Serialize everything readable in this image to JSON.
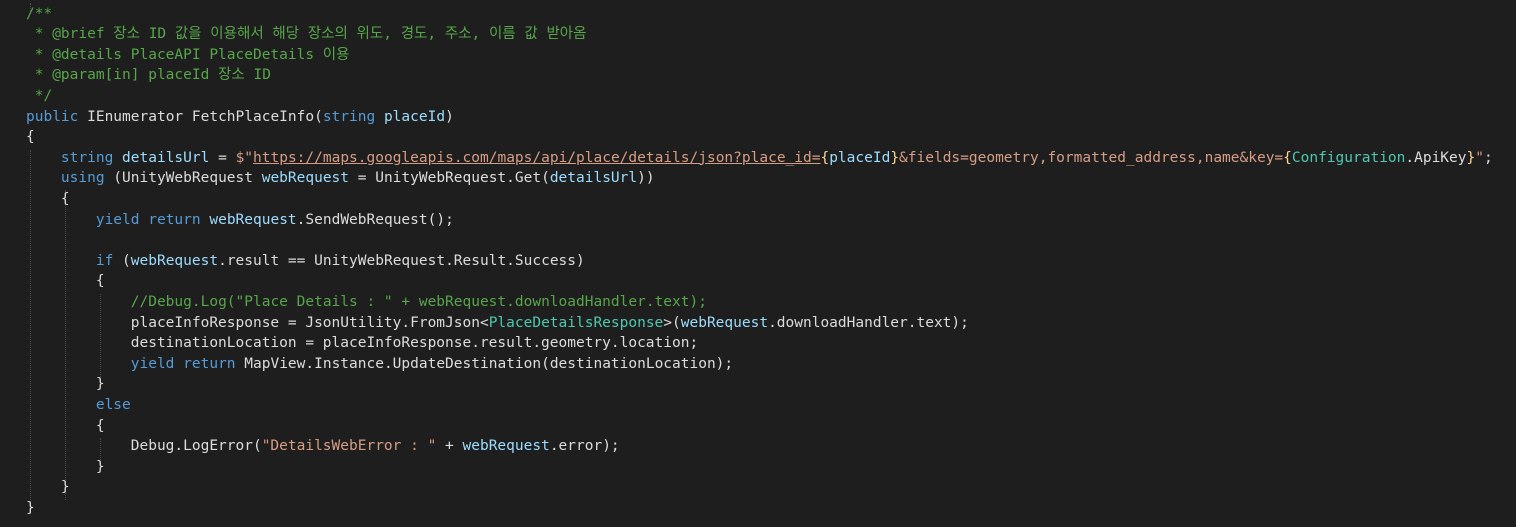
{
  "colors": {
    "background": "#1e1e1e",
    "default": "#dcdcdc",
    "keyword": "#569cd6",
    "comment": "#57a64a",
    "string": "#d69d85",
    "interp": "#ffd68f",
    "type": "#4ec9b0",
    "variable": "#9cdcfe",
    "indent_guide": "#4b4b4b"
  },
  "code": {
    "lines": [
      [
        {
          "t": "/**",
          "c": "comment"
        }
      ],
      [
        {
          "t": " * @brief 장소 ID 값을 이용해서 해당 장소의 위도, 경도, 주소, 이름 값 받아옴",
          "c": "comment"
        }
      ],
      [
        {
          "t": " * @details PlaceAPI PlaceDetails 이용",
          "c": "comment"
        }
      ],
      [
        {
          "t": " * @param[in] placeId 장소 ID",
          "c": "comment"
        }
      ],
      [
        {
          "t": " */",
          "c": "comment"
        }
      ],
      [
        {
          "t": "public",
          "c": "keyword"
        },
        {
          "t": " IEnumerator FetchPlaceInfo(",
          "c": "default"
        },
        {
          "t": "string",
          "c": "keyword"
        },
        {
          "t": " ",
          "c": "default"
        },
        {
          "t": "placeId",
          "c": "variable"
        },
        {
          "t": ")",
          "c": "default"
        }
      ],
      [
        {
          "t": "{",
          "c": "default"
        }
      ],
      [
        {
          "t": "    ",
          "c": "default"
        },
        {
          "t": "string",
          "c": "keyword"
        },
        {
          "t": " ",
          "c": "default"
        },
        {
          "t": "detailsUrl",
          "c": "variable"
        },
        {
          "t": " = ",
          "c": "default"
        },
        {
          "t": "$\"",
          "c": "string"
        },
        {
          "t": "https://maps.googleapis.com/maps/api/place/details/json?place_id=",
          "c": "string",
          "u": true
        },
        {
          "t": "{",
          "c": "interp"
        },
        {
          "t": "placeId",
          "c": "variable"
        },
        {
          "t": "}",
          "c": "interp"
        },
        {
          "t": "&fields=geometry,formatted_address,name&key=",
          "c": "string"
        },
        {
          "t": "{",
          "c": "interp"
        },
        {
          "t": "Configuration",
          "c": "type"
        },
        {
          "t": ".ApiKey",
          "c": "default"
        },
        {
          "t": "}",
          "c": "interp"
        },
        {
          "t": "\"",
          "c": "string"
        },
        {
          "t": ";",
          "c": "default"
        }
      ],
      [
        {
          "t": "    ",
          "c": "default"
        },
        {
          "t": "using",
          "c": "keyword"
        },
        {
          "t": " (UnityWebRequest ",
          "c": "default"
        },
        {
          "t": "webRequest",
          "c": "variable"
        },
        {
          "t": " = UnityWebRequest.Get(",
          "c": "default"
        },
        {
          "t": "detailsUrl",
          "c": "variable"
        },
        {
          "t": "))",
          "c": "default"
        }
      ],
      [
        {
          "t": "    {",
          "c": "default"
        }
      ],
      [
        {
          "t": "        ",
          "c": "default"
        },
        {
          "t": "yield",
          "c": "keyword"
        },
        {
          "t": " ",
          "c": "default"
        },
        {
          "t": "return",
          "c": "keyword"
        },
        {
          "t": " ",
          "c": "default"
        },
        {
          "t": "webRequest",
          "c": "variable"
        },
        {
          "t": ".SendWebRequest();",
          "c": "default"
        }
      ],
      [],
      [
        {
          "t": "        ",
          "c": "default"
        },
        {
          "t": "if",
          "c": "keyword"
        },
        {
          "t": " (",
          "c": "default"
        },
        {
          "t": "webRequest",
          "c": "variable"
        },
        {
          "t": ".result == UnityWebRequest.Result.Success)",
          "c": "default"
        }
      ],
      [
        {
          "t": "        {",
          "c": "default"
        }
      ],
      [
        {
          "t": "            ",
          "c": "default"
        },
        {
          "t": "//Debug.Log(\"Place Details : \" + webRequest.downloadHandler.text);",
          "c": "comment"
        }
      ],
      [
        {
          "t": "            placeInfoResponse = JsonUtility.FromJson<",
          "c": "default"
        },
        {
          "t": "PlaceDetailsResponse",
          "c": "type"
        },
        {
          "t": ">(",
          "c": "default"
        },
        {
          "t": "webRequest",
          "c": "variable"
        },
        {
          "t": ".downloadHandler.text);",
          "c": "default"
        }
      ],
      [
        {
          "t": "            destinationLocation = placeInfoResponse.result.geometry.location;",
          "c": "default"
        }
      ],
      [
        {
          "t": "            ",
          "c": "default"
        },
        {
          "t": "yield",
          "c": "keyword"
        },
        {
          "t": " ",
          "c": "default"
        },
        {
          "t": "return",
          "c": "keyword"
        },
        {
          "t": " MapView.Instance.UpdateDestination(destinationLocation);",
          "c": "default"
        }
      ],
      [
        {
          "t": "        }",
          "c": "default"
        }
      ],
      [
        {
          "t": "        ",
          "c": "default"
        },
        {
          "t": "else",
          "c": "keyword"
        }
      ],
      [
        {
          "t": "        {",
          "c": "default"
        }
      ],
      [
        {
          "t": "            Debug.LogError(",
          "c": "default"
        },
        {
          "t": "\"DetailsWebError : \"",
          "c": "string"
        },
        {
          "t": " + ",
          "c": "default"
        },
        {
          "t": "webRequest",
          "c": "variable"
        },
        {
          "t": ".error);",
          "c": "default"
        }
      ],
      [
        {
          "t": "        }",
          "c": "default"
        }
      ],
      [
        {
          "t": "    }",
          "c": "default"
        }
      ],
      [
        {
          "t": "}",
          "c": "default"
        }
      ]
    ]
  }
}
